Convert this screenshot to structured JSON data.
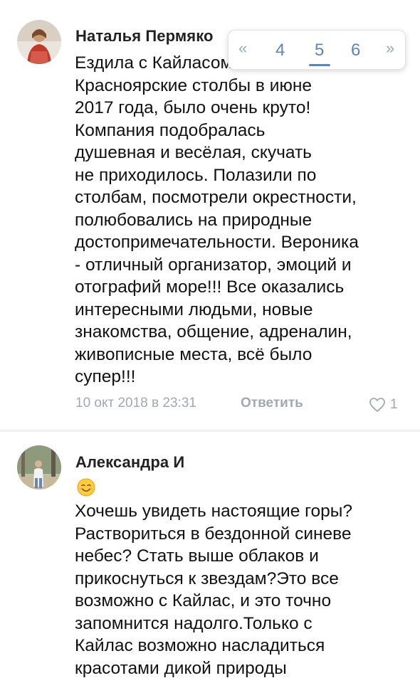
{
  "comments": [
    {
      "author": "Наталья Пермяко",
      "lines": [
        "Ездила с Кайласом на",
        "Красноярские столбы в июне",
        "2017 года, было очень круто!",
        "Компания подобралась",
        "душевная и весёлая, скучать",
        "не приходилось. Полазили по",
        "столбам, посмотрели окрестности,",
        "полюбовались на природные",
        "достопримечательности. Вероника",
        "- отличный организатор, эмоций и",
        "отографий море!!! Все оказались",
        "интересными людьми, новые",
        "знакомства, общение, адреналин,",
        "живописные места, всё было",
        "супер!!!"
      ],
      "date": "10 окт 2018 в 23:31",
      "reply_label": "Ответить",
      "likes": "1"
    },
    {
      "author": "Александра И",
      "emoji": "smiling-face-emoji",
      "lines": [
        "Хочешь увидеть настоящие горы?",
        "Раствориться в бездонной синеве",
        "небес? Стать выше облаков и",
        "прикоснуться к звездам?Это все",
        "возможно с Кайлас, и это точно",
        "запомнится надолго.Только с",
        "Кайлас возможно насладиться",
        "красотами дикой природы"
      ]
    }
  ],
  "pager": {
    "prev": "«",
    "pages": [
      "4",
      "5",
      "6"
    ],
    "current": "5",
    "next": "»"
  },
  "colors": {
    "text": "#111111",
    "meta": "#a3a8b0",
    "accent": "#5f85b3",
    "divider": "#eef0f2"
  }
}
